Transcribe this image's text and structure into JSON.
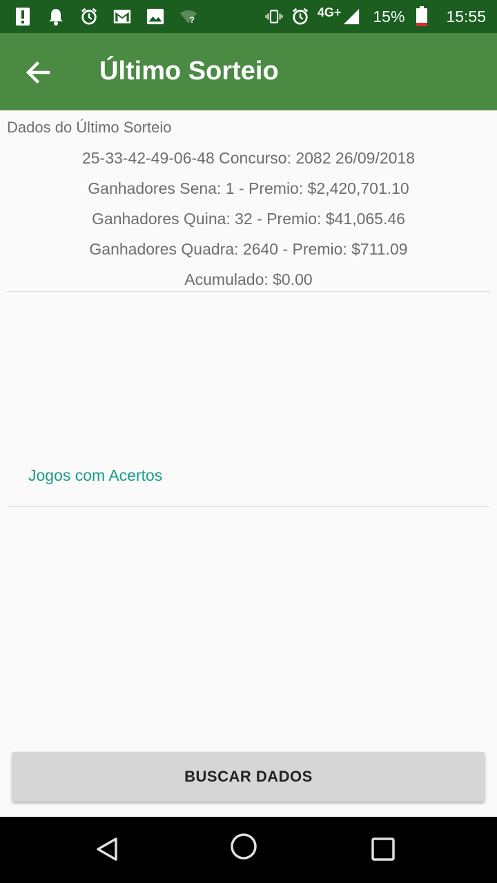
{
  "status_bar": {
    "network": "4G+",
    "battery": "15%",
    "time": "15:55",
    "icons_left": [
      "alert-icon",
      "notification-bell-icon",
      "alarm-icon",
      "gmail-icon",
      "image-icon",
      "wifi-unknown-icon"
    ],
    "icons_right": [
      "vibrate-icon",
      "alarm-icon",
      "signal-icon",
      "battery-icon"
    ]
  },
  "app_bar": {
    "title": "Último Sorteio",
    "back_icon": "arrow-back-icon"
  },
  "draw": {
    "section_label": "Dados do Último Sorteio",
    "numbers_line": "25-33-42-49-06-48  Concurso: 2082  26/09/2018",
    "sena_line": "Ganhadores Sena: 1 - Premio: $2,420,701.10",
    "quina_line": "Ganhadores Quina: 32 - Premio: $41,065.46",
    "quadra_line": "Ganhadores Quadra: 2640 - Premio: $711.09",
    "accumulated_line": "Acumulado: $0.00"
  },
  "hits": {
    "label": "Jogos com Acertos"
  },
  "actions": {
    "search_button": "BUSCAR DADOS"
  },
  "nav_bar": {
    "buttons": [
      "back-triangle-icon",
      "home-circle-icon",
      "recents-square-icon"
    ]
  },
  "colors": {
    "status_bar": "#1b5e20",
    "app_bar": "#4a8a43",
    "accent": "#1a9a8a",
    "background": "#fafafa"
  }
}
